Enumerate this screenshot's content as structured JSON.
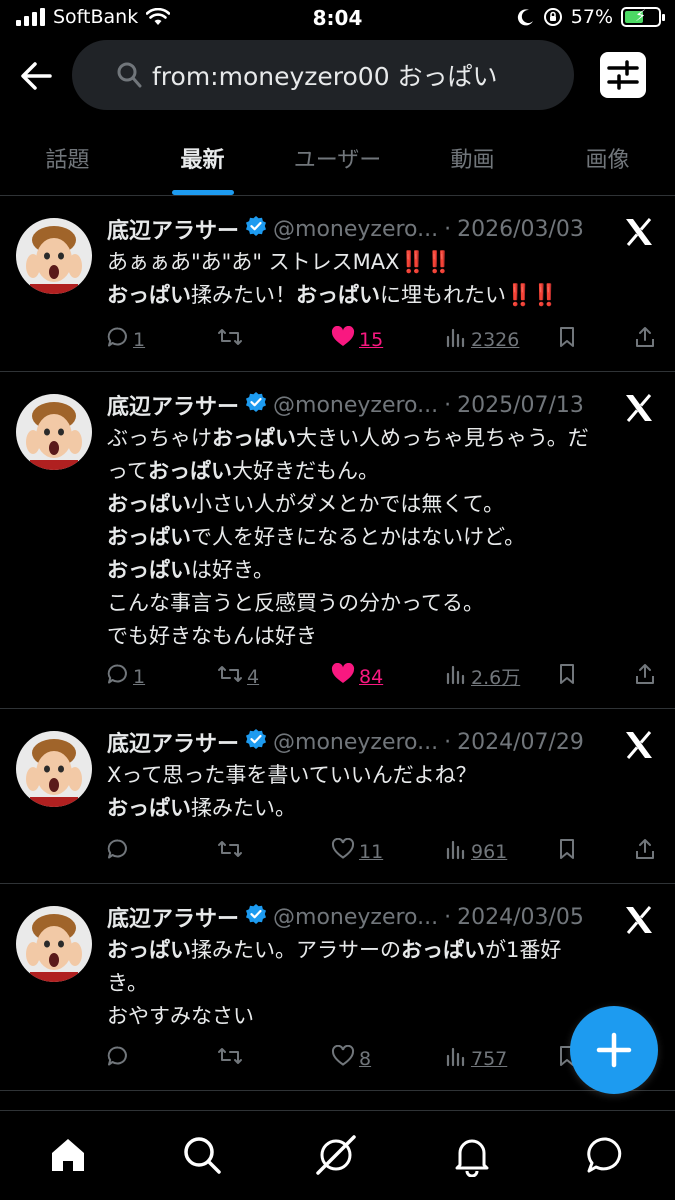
{
  "status_bar": {
    "carrier": "SoftBank",
    "time": "8:04",
    "battery_percent": "57%"
  },
  "search": {
    "query": "from:moneyzero00 おっぱい"
  },
  "tabs": [
    {
      "label": "話題",
      "active": false
    },
    {
      "label": "最新",
      "active": true
    },
    {
      "label": "ユーザー",
      "active": false
    },
    {
      "label": "動画",
      "active": false
    },
    {
      "label": "画像",
      "active": false
    }
  ],
  "tweets": [
    {
      "name": "底辺アラサー",
      "handle": "@moneyzero...",
      "dot": "·",
      "date": "2026/03/03",
      "lines": [
        [
          {
            "t": "あぁぁあ\"あ\"あ\" ストレスMAX"
          },
          {
            "t": "‼️‼️",
            "excl": true
          }
        ],
        [
          {
            "t": "おっぱい",
            "b": true
          },
          {
            "t": "揉みたい！"
          },
          {
            "t": "おっぱい",
            "b": true
          },
          {
            "t": "に埋もれたい"
          },
          {
            "t": "‼️‼️",
            "excl": true
          }
        ]
      ],
      "replies": "1",
      "reposts": "",
      "likes": "15",
      "liked": true,
      "views": "2326"
    },
    {
      "name": "底辺アラサー",
      "handle": "@moneyzero...",
      "dot": "·",
      "date": "2025/07/13",
      "lines": [
        [
          {
            "t": "ぶっちゃけ"
          },
          {
            "t": "おっぱい",
            "b": true
          },
          {
            "t": "大きい人めっちゃ見ちゃう。だ"
          }
        ],
        [
          {
            "t": "って"
          },
          {
            "t": "おっぱい",
            "b": true
          },
          {
            "t": "大好きだもん。"
          }
        ],
        [
          {
            "t": "おっぱい",
            "b": true
          },
          {
            "t": "小さい人がダメとかでは無くて。"
          }
        ],
        [
          {
            "t": "おっぱい",
            "b": true
          },
          {
            "t": "で人を好きになるとかはないけど。"
          }
        ],
        [
          {
            "t": "おっぱい",
            "b": true
          },
          {
            "t": "は好き。"
          }
        ],
        [
          {
            "t": "こんな事言うと反感買うの分かってる。"
          }
        ],
        [
          {
            "t": "でも好きなもんは好き"
          }
        ]
      ],
      "replies": "1",
      "reposts": "4",
      "likes": "84",
      "liked": true,
      "views": "2.6万"
    },
    {
      "name": "底辺アラサー",
      "handle": "@moneyzero...",
      "dot": "·",
      "date": "2024/07/29",
      "lines": [
        [
          {
            "t": "Xって思った事を書いていいんだよね？"
          }
        ],
        [
          {
            "t": "おっぱい",
            "b": true
          },
          {
            "t": "揉みたい。"
          }
        ]
      ],
      "replies": "",
      "reposts": "",
      "likes": "11",
      "liked": false,
      "views": "961"
    },
    {
      "name": "底辺アラサー",
      "handle": "@moneyzero...",
      "dot": "·",
      "date": "2024/03/05",
      "lines": [
        [
          {
            "t": "おっぱい",
            "b": true
          },
          {
            "t": "揉みたい。アラサーの"
          },
          {
            "t": "おっぱい",
            "b": true
          },
          {
            "t": "が1番好"
          }
        ],
        [
          {
            "t": "き。"
          }
        ],
        [
          {
            "t": "おやすみなさい"
          }
        ]
      ],
      "replies": "",
      "reposts": "",
      "likes": "8",
      "liked": false,
      "views": "757"
    }
  ],
  "icons": {
    "back": "arrow-left-icon",
    "search": "search-icon",
    "filter": "sliders-icon",
    "x_logo": "x-logo-icon",
    "verified": "verified-badge-icon",
    "compose": "plus-icon",
    "nav": [
      "home-icon",
      "search-icon",
      "grok-icon",
      "bell-icon",
      "message-icon"
    ]
  },
  "colors": {
    "accent": "#1d9bf0",
    "like": "#f91880",
    "muted": "#71767b",
    "battery": "#4cd964"
  }
}
